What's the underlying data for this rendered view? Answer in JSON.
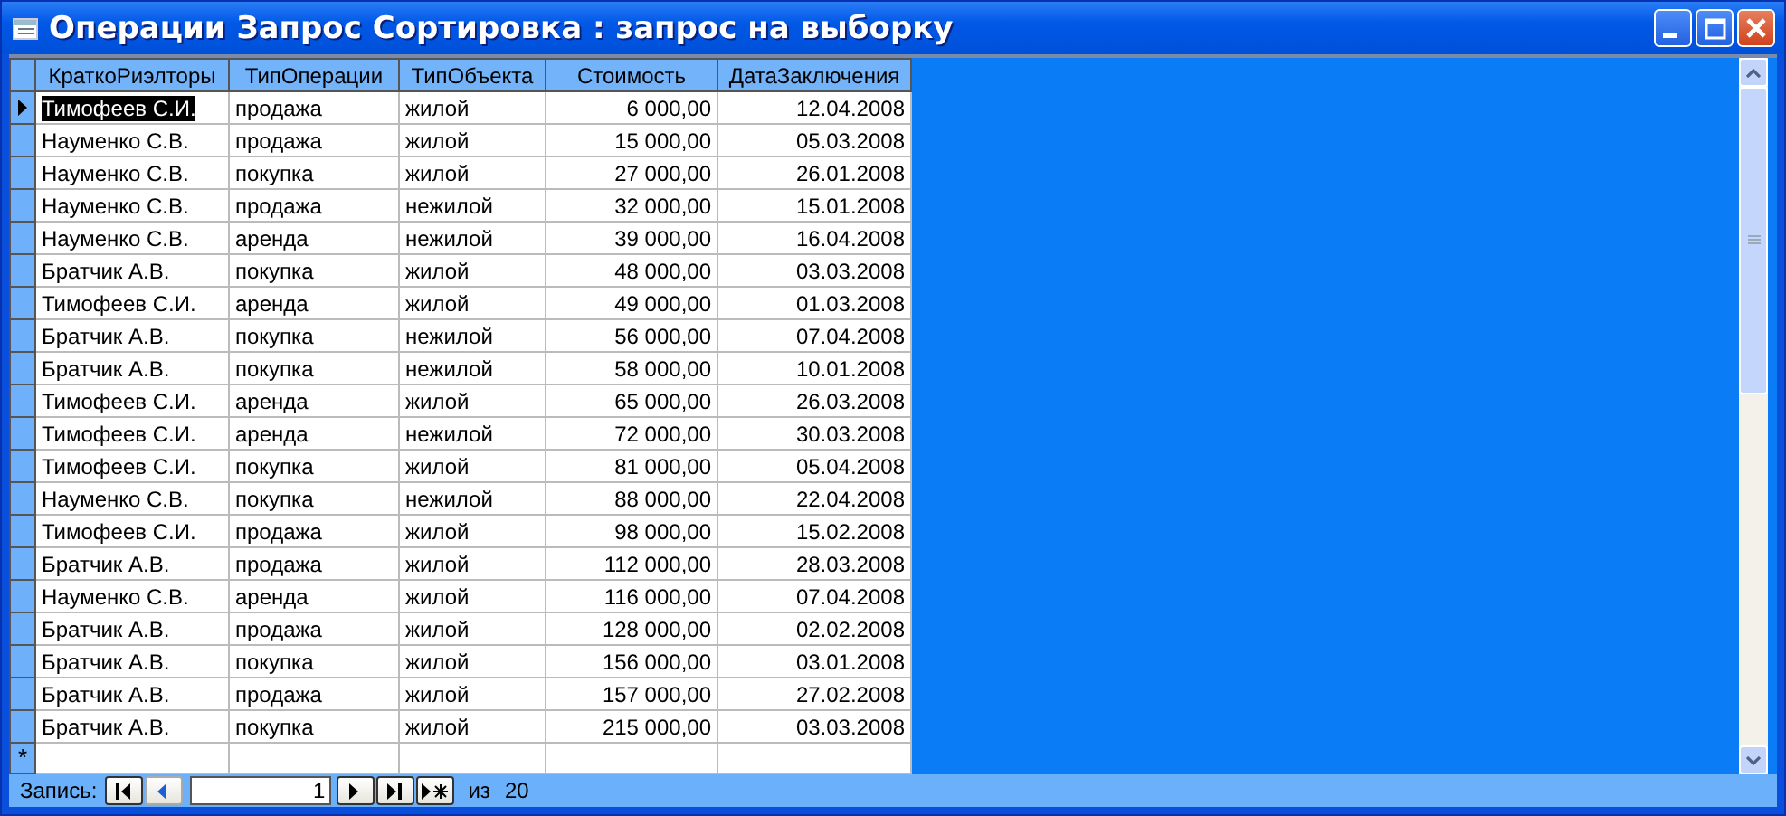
{
  "window": {
    "title": "Операции Запрос Сортировка : запрос на выборку"
  },
  "table": {
    "columns": [
      "КраткоРиэлторы",
      "ТипОперации",
      "ТипОбъекта",
      "Стоимость",
      "ДатаЗаключения"
    ],
    "rows": [
      {
        "current": true,
        "cells": [
          "Тимофеев С.И.",
          "продажа",
          "жилой",
          "6 000,00",
          "12.04.2008"
        ]
      },
      {
        "current": false,
        "cells": [
          "Науменко С.В.",
          "продажа",
          "жилой",
          "15 000,00",
          "05.03.2008"
        ]
      },
      {
        "current": false,
        "cells": [
          "Науменко С.В.",
          "покупка",
          "жилой",
          "27 000,00",
          "26.01.2008"
        ]
      },
      {
        "current": false,
        "cells": [
          "Науменко С.В.",
          "продажа",
          "нежилой",
          "32 000,00",
          "15.01.2008"
        ]
      },
      {
        "current": false,
        "cells": [
          "Науменко С.В.",
          "аренда",
          "нежилой",
          "39 000,00",
          "16.04.2008"
        ]
      },
      {
        "current": false,
        "cells": [
          "Братчик А.В.",
          "покупка",
          "жилой",
          "48 000,00",
          "03.03.2008"
        ]
      },
      {
        "current": false,
        "cells": [
          "Тимофеев С.И.",
          "аренда",
          "жилой",
          "49 000,00",
          "01.03.2008"
        ]
      },
      {
        "current": false,
        "cells": [
          "Братчик А.В.",
          "покупка",
          "нежилой",
          "56 000,00",
          "07.04.2008"
        ]
      },
      {
        "current": false,
        "cells": [
          "Братчик А.В.",
          "покупка",
          "нежилой",
          "58 000,00",
          "10.01.2008"
        ]
      },
      {
        "current": false,
        "cells": [
          "Тимофеев С.И.",
          "аренда",
          "жилой",
          "65 000,00",
          "26.03.2008"
        ]
      },
      {
        "current": false,
        "cells": [
          "Тимофеев С.И.",
          "аренда",
          "нежилой",
          "72 000,00",
          "30.03.2008"
        ]
      },
      {
        "current": false,
        "cells": [
          "Тимофеев С.И.",
          "покупка",
          "жилой",
          "81 000,00",
          "05.04.2008"
        ]
      },
      {
        "current": false,
        "cells": [
          "Науменко С.В.",
          "покупка",
          "нежилой",
          "88 000,00",
          "22.04.2008"
        ]
      },
      {
        "current": false,
        "cells": [
          "Тимофеев С.И.",
          "продажа",
          "жилой",
          "98 000,00",
          "15.02.2008"
        ]
      },
      {
        "current": false,
        "cells": [
          "Братчик А.В.",
          "продажа",
          "жилой",
          "112 000,00",
          "28.03.2008"
        ]
      },
      {
        "current": false,
        "cells": [
          "Науменко С.В.",
          "аренда",
          "жилой",
          "116 000,00",
          "07.04.2008"
        ]
      },
      {
        "current": false,
        "cells": [
          "Братчик А.В.",
          "продажа",
          "жилой",
          "128 000,00",
          "02.02.2008"
        ]
      },
      {
        "current": false,
        "cells": [
          "Братчик А.В.",
          "покупка",
          "жилой",
          "156 000,00",
          "03.01.2008"
        ]
      },
      {
        "current": false,
        "cells": [
          "Братчик А.В.",
          "продажа",
          "жилой",
          "157 000,00",
          "27.02.2008"
        ]
      },
      {
        "current": false,
        "cells": [
          "Братчик А.В.",
          "покупка",
          "жилой",
          "215 000,00",
          "03.03.2008"
        ]
      }
    ],
    "new_row_marker": "*"
  },
  "navigator": {
    "label": "Запись:",
    "record": "1",
    "of_label": "из",
    "total": "20",
    "buttons": [
      {
        "kind": "first",
        "disabled": false
      },
      {
        "kind": "prev",
        "disabled": true
      },
      {
        "kind": "next",
        "disabled": false
      },
      {
        "kind": "last",
        "disabled": false
      },
      {
        "kind": "new",
        "disabled": false
      }
    ]
  }
}
